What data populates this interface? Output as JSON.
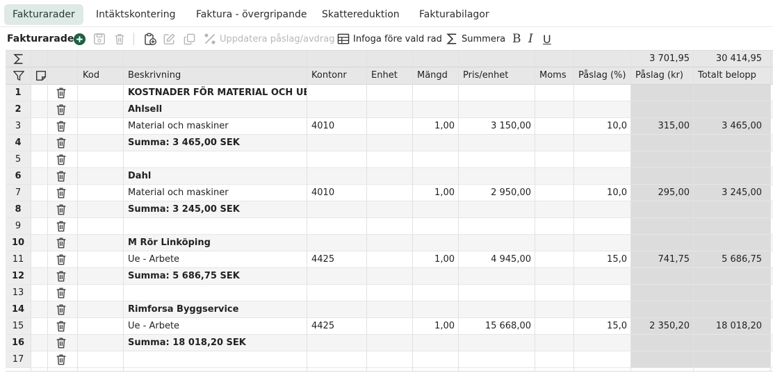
{
  "tabs": [
    {
      "label": "Fakturarader",
      "active": true
    },
    {
      "label": "Intäktskontering",
      "active": false
    },
    {
      "label": "Faktura - övergripande",
      "active": false
    },
    {
      "label": "Skattereduktion",
      "active": false
    },
    {
      "label": "Fakturabilagor",
      "active": false
    }
  ],
  "toolbar": {
    "title": "Fakturarader",
    "update_label": "Uppdatera påslag/avdrag",
    "insert_label": "Infoga före vald rad",
    "sum_label": "Summera",
    "bold": "B",
    "italic": "I",
    "underline": "U"
  },
  "colors": {
    "accent": "#1f5f45",
    "tab_active_bg": "#dfe9e5",
    "header_bg": "#e7e7e7",
    "computed_col_bg": "#dcdcdc"
  },
  "totals": {
    "paslag_kr": "3 701,95",
    "totalt_belopp": "30 414,95"
  },
  "columns": {
    "kod": "Kod",
    "beskrivning": "Beskrivning",
    "kontonr": "Kontonr",
    "enhet": "Enhet",
    "mangd": "Mängd",
    "pris": "Pris/enhet",
    "moms": "Moms",
    "paslag_pct": "Påslag (%)",
    "paslag_kr": "Påslag (kr)",
    "totalt": "Totalt belopp"
  },
  "rows": [
    {
      "num": "1",
      "bold": true,
      "desc": "KOSTNADER FÖR MATERIAL OCH UE",
      "kontonr": "",
      "mangd": "",
      "pris": "",
      "paslag_pct": "",
      "paslag_kr": "",
      "totalt": ""
    },
    {
      "num": "2",
      "bold": true,
      "desc": "Ahlsell",
      "kontonr": "",
      "mangd": "",
      "pris": "",
      "paslag_pct": "",
      "paslag_kr": "",
      "totalt": ""
    },
    {
      "num": "3",
      "bold": false,
      "desc": "Material och maskiner",
      "kontonr": "4010",
      "mangd": "1,00",
      "pris": "3 150,00",
      "paslag_pct": "10,0",
      "paslag_kr": "315,00",
      "totalt": "3 465,00"
    },
    {
      "num": "4",
      "bold": true,
      "desc": "Summa: 3 465,00 SEK",
      "kontonr": "",
      "mangd": "",
      "pris": "",
      "paslag_pct": "",
      "paslag_kr": "",
      "totalt": ""
    },
    {
      "num": "5",
      "bold": false,
      "desc": "",
      "kontonr": "",
      "mangd": "",
      "pris": "",
      "paslag_pct": "",
      "paslag_kr": "",
      "totalt": ""
    },
    {
      "num": "6",
      "bold": true,
      "desc": "Dahl",
      "kontonr": "",
      "mangd": "",
      "pris": "",
      "paslag_pct": "",
      "paslag_kr": "",
      "totalt": ""
    },
    {
      "num": "7",
      "bold": false,
      "desc": "Material och maskiner",
      "kontonr": "4010",
      "mangd": "1,00",
      "pris": "2 950,00",
      "paslag_pct": "10,0",
      "paslag_kr": "295,00",
      "totalt": "3 245,00"
    },
    {
      "num": "8",
      "bold": true,
      "desc": "Summa: 3 245,00 SEK",
      "kontonr": "",
      "mangd": "",
      "pris": "",
      "paslag_pct": "",
      "paslag_kr": "",
      "totalt": ""
    },
    {
      "num": "9",
      "bold": false,
      "desc": "",
      "kontonr": "",
      "mangd": "",
      "pris": "",
      "paslag_pct": "",
      "paslag_kr": "",
      "totalt": ""
    },
    {
      "num": "10",
      "bold": true,
      "desc": "M Rör Linköping",
      "kontonr": "",
      "mangd": "",
      "pris": "",
      "paslag_pct": "",
      "paslag_kr": "",
      "totalt": ""
    },
    {
      "num": "11",
      "bold": false,
      "desc": "Ue - Arbete",
      "kontonr": "4425",
      "mangd": "1,00",
      "pris": "4 945,00",
      "paslag_pct": "15,0",
      "paslag_kr": "741,75",
      "totalt": "5 686,75"
    },
    {
      "num": "12",
      "bold": true,
      "desc": "Summa: 5 686,75 SEK",
      "kontonr": "",
      "mangd": "",
      "pris": "",
      "paslag_pct": "",
      "paslag_kr": "",
      "totalt": ""
    },
    {
      "num": "13",
      "bold": false,
      "desc": "",
      "kontonr": "",
      "mangd": "",
      "pris": "",
      "paslag_pct": "",
      "paslag_kr": "",
      "totalt": ""
    },
    {
      "num": "14",
      "bold": true,
      "desc": "Rimforsa Byggservice",
      "kontonr": "",
      "mangd": "",
      "pris": "",
      "paslag_pct": "",
      "paslag_kr": "",
      "totalt": ""
    },
    {
      "num": "15",
      "bold": false,
      "desc": "Ue - Arbete",
      "kontonr": "4425",
      "mangd": "1,00",
      "pris": "15 668,00",
      "paslag_pct": "15,0",
      "paslag_kr": "2 350,20",
      "totalt": "18 018,20"
    },
    {
      "num": "16",
      "bold": true,
      "desc": "Summa: 18 018,20 SEK",
      "kontonr": "",
      "mangd": "",
      "pris": "",
      "paslag_pct": "",
      "paslag_kr": "",
      "totalt": ""
    },
    {
      "num": "17",
      "bold": false,
      "desc": "",
      "kontonr": "",
      "mangd": "",
      "pris": "",
      "paslag_pct": "",
      "paslag_kr": "",
      "totalt": ""
    }
  ]
}
